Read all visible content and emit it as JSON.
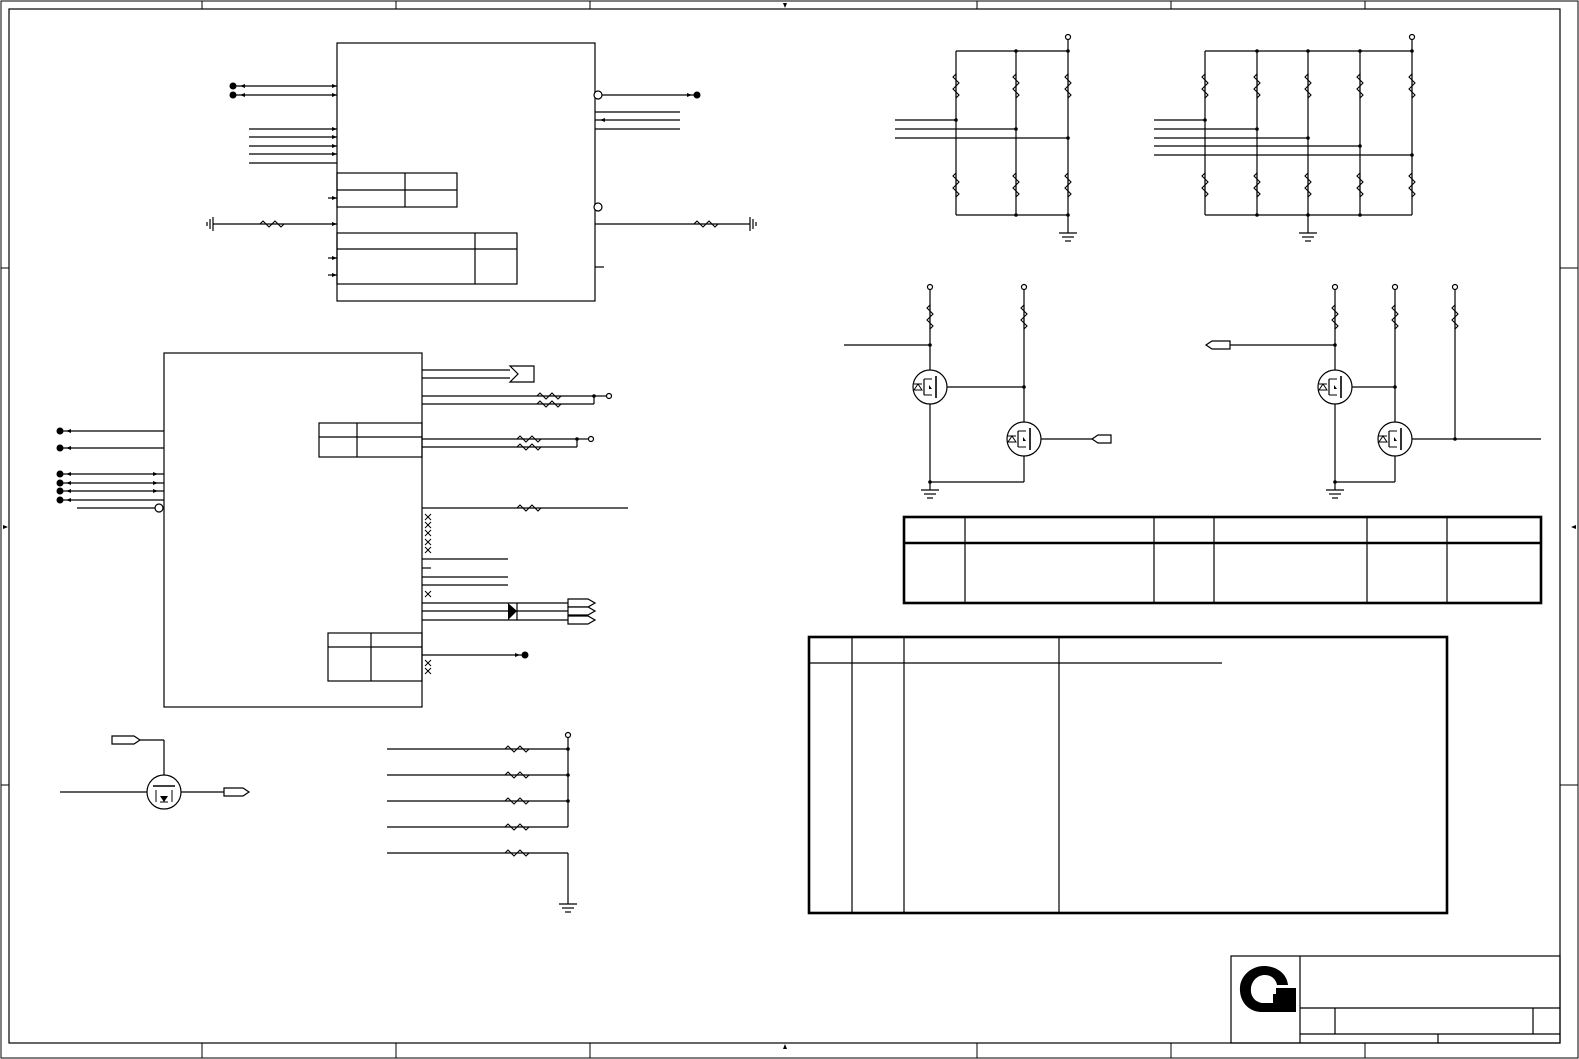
{
  "diagram": {
    "kind": "schematic",
    "line_color": "#000000",
    "background": "#ffffff"
  },
  "title_block": {
    "logo_icon": "company-logo-icon"
  }
}
